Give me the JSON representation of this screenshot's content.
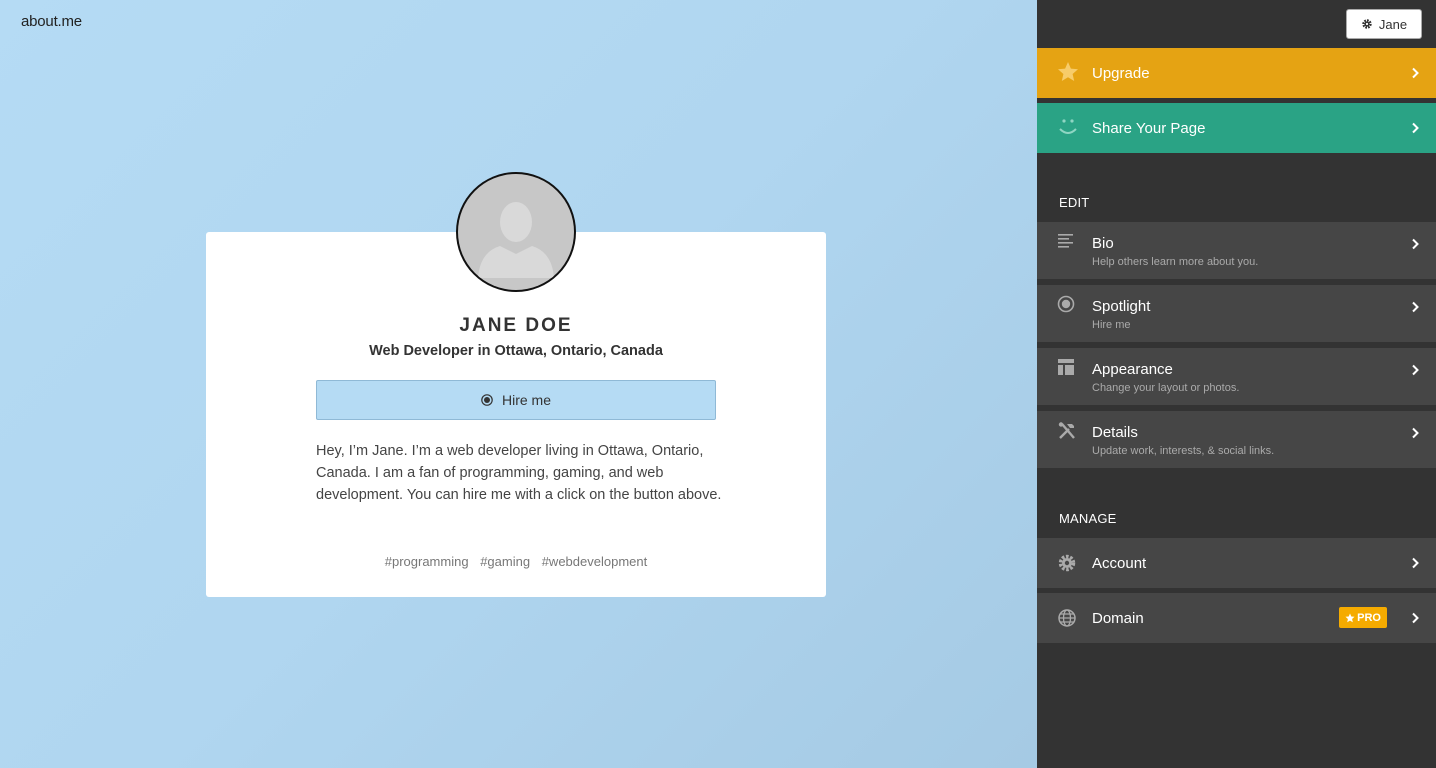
{
  "app": {
    "logo": "about.me"
  },
  "profile": {
    "name": "JANE DOE",
    "headline": "Web Developer in Ottawa, Ontario, Canada",
    "cta_label": "Hire me",
    "bio": "Hey, I’m Jane. I’m a web developer living in Ottawa, Ontario, Canada. I am a fan of programming, gaming, and web development. You can hire me with a click on the button above.",
    "tags": [
      "#programming",
      "#gaming",
      "#webdevelopment"
    ]
  },
  "sidebar": {
    "user_button": "Jane",
    "upgrade": {
      "label": "Upgrade",
      "color": "#e5a313"
    },
    "share": {
      "label": "Share Your Page",
      "color": "#2aa385"
    },
    "edit_heading": "EDIT",
    "edit_items": [
      {
        "label": "Bio",
        "sub": "Help others learn more about you.",
        "icon": "bio-lines-icon"
      },
      {
        "label": "Spotlight",
        "sub": "Hire me",
        "icon": "target-icon"
      },
      {
        "label": "Appearance",
        "sub": "Change your layout or photos.",
        "icon": "layout-icon"
      },
      {
        "label": "Details",
        "sub": "Update work, interests, & social links.",
        "icon": "tools-icon"
      }
    ],
    "manage_heading": "MANAGE",
    "manage_items": [
      {
        "label": "Account",
        "icon": "gear-icon"
      },
      {
        "label": "Domain",
        "icon": "globe-icon",
        "badge": "PRO"
      }
    ]
  }
}
